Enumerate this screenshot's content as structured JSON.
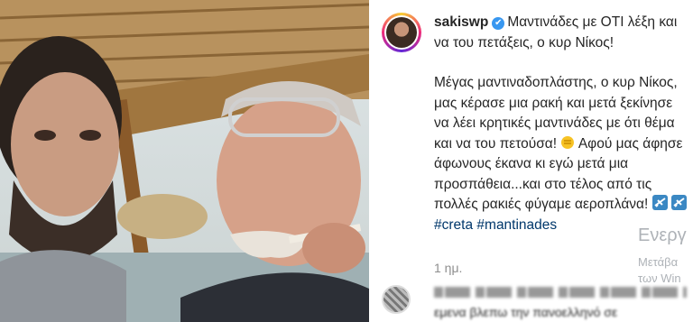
{
  "post": {
    "username": "sakiswp",
    "verified_glyph": "✔",
    "caption_line1": "Μαντινάδες με ΟΤΙ λέξη και να του πετάξεις, ο κυρ Νίκος!",
    "caption_body": "Μέγας μαντιναδοπλάστης, ο κυρ Νίκος, μας κέρασε μια ρακή και μετά ξεκίνησε να λέει κρητικές μαντινάδες με ότι θέμα και να του πετούσα!",
    "caption_body2": "Αφού μας άφησε άφωνους έκανα κι εγώ μετά μια προσπάθεια...και στο τέλος από τις πολλές ρακιές φύγαμε αεροπλάνα!",
    "hashtag1": "#creta",
    "hashtag2": "#mantinades",
    "emoji_icons": [
      "fist-icon",
      "airplane-icon",
      "airplane-icon"
    ],
    "timestamp": "1 ημ.",
    "comment_partial": "εμενα βλεπω την πανοελληνό σε",
    "accent_color": "#3897f0",
    "tag_color": "#00376b"
  },
  "watermark": {
    "line1": "Ενεργ",
    "line2": "Μετάβα",
    "line3": "των Win"
  }
}
